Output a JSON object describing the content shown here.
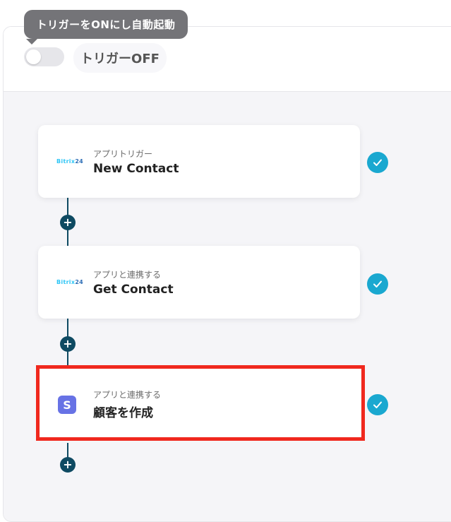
{
  "header": {
    "tooltip": "トリガーをONにし自動起動",
    "toggle_state": "off",
    "status_label": "トリガーOFF"
  },
  "logos": {
    "bitrix_text": "Bitrix",
    "bitrix_num": "24",
    "stripe_letter": "S"
  },
  "steps": [
    {
      "subtitle": "アプリトリガー",
      "title": "New Contact",
      "app": "Bitrix24",
      "completed": true
    },
    {
      "subtitle": "アプリと連携する",
      "title": "Get Contact",
      "app": "Bitrix24",
      "completed": true
    },
    {
      "subtitle": "アプリと連携する",
      "title": "顧客を作成",
      "app": "Stripe",
      "completed": true
    }
  ],
  "add_symbol": "+",
  "colors": {
    "check": "#1aa8d0",
    "connector": "#0e4a62",
    "highlight": "#f0281e",
    "stripe": "#6772e5",
    "bitrix": "#2fc6f6"
  }
}
